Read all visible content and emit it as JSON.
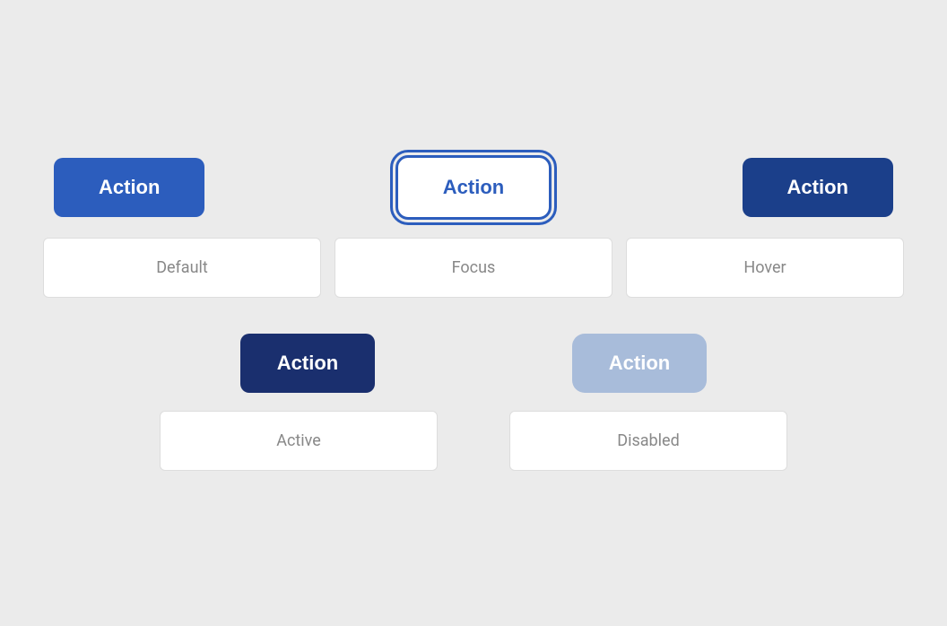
{
  "buttons": {
    "default": {
      "label": "Action",
      "state": "default"
    },
    "focus": {
      "label": "Action",
      "state": "focus"
    },
    "hover": {
      "label": "Action",
      "state": "hover"
    },
    "active": {
      "label": "Action",
      "state": "active"
    },
    "disabled": {
      "label": "Action",
      "state": "disabled"
    }
  },
  "labels": {
    "default": "Default",
    "focus": "Focus",
    "hover": "Hover",
    "active": "Active",
    "disabled": "Disabled"
  },
  "colors": {
    "brand_blue": "#2c5dbd",
    "brand_dark_blue": "#1a2f6e",
    "brand_hover_blue": "#1b3f8a",
    "brand_disabled": "#a8bcda",
    "bg": "#ebebeb",
    "white": "#ffffff"
  }
}
